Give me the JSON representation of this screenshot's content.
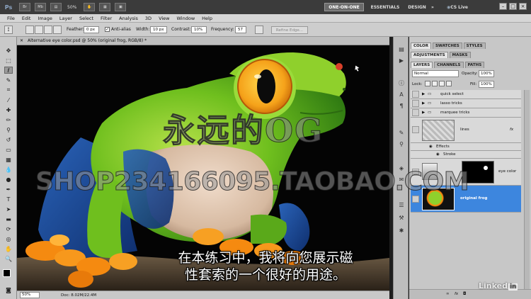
{
  "app": {
    "logo": "Ps",
    "mini_buttons": [
      "Br",
      "Mb"
    ],
    "zoom": "50%",
    "workspaces": [
      {
        "label": "ONE-ON-ONE",
        "active": true
      },
      {
        "label": "ESSENTIALS",
        "active": false
      },
      {
        "label": "DESIGN",
        "active": false
      },
      {
        "label": "»",
        "active": false
      }
    ],
    "cs_live": "CS Live",
    "window_controls": [
      "–",
      "□",
      "×"
    ]
  },
  "menu": [
    "File",
    "Edit",
    "Image",
    "Layer",
    "Select",
    "Filter",
    "Analysis",
    "3D",
    "View",
    "Window",
    "Help"
  ],
  "options": {
    "feather_label": "Feather:",
    "feather_value": "0 px",
    "antialias_label": "Anti-alias",
    "antialias_checked": "✓",
    "width_label": "Width:",
    "width_value": "10 px",
    "contrast_label": "Contrast:",
    "contrast_value": "10%",
    "frequency_label": "Frequency:",
    "frequency_value": "57",
    "refine_label": "Refine Edge..."
  },
  "document": {
    "tab_title": "Alternative eye color.psd @ 50% (original frog, RGB/8) *",
    "status_zoom": "50%",
    "status_doc": "Doc: 8.02M/22.4M"
  },
  "panels": {
    "top_tabs": [
      "COLOR",
      "SWATCHES",
      "STYLES"
    ],
    "mid_tabs": [
      "ADJUSTMENTS",
      "MASKS"
    ],
    "layer_tabs": [
      "LAYERS",
      "CHANNELS",
      "PATHS"
    ],
    "blend_mode": "Normal",
    "opacity_label": "Opacity:",
    "opacity_value": "100%",
    "lock_label": "Lock:",
    "fill_label": "Fill:",
    "fill_value": "100%",
    "layers": [
      {
        "name": "quick select",
        "kind": "group"
      },
      {
        "name": "lasso tricks",
        "kind": "group"
      },
      {
        "name": "marquee tricks",
        "kind": "group"
      },
      {
        "name": "lines",
        "kind": "layer"
      },
      {
        "name": "Effects",
        "kind": "effect"
      },
      {
        "name": "Stroke",
        "kind": "effect"
      },
      {
        "name": "eye color",
        "kind": "layer"
      },
      {
        "name": "original frog",
        "kind": "layer"
      }
    ],
    "fx_label": "fx"
  },
  "overlay": {
    "watermark_cn": "永远的OG",
    "watermark_shop": "SHOP234166095.TAOBAO.COM",
    "subtitle_line1": "在本练习中，我将向您展示磁",
    "subtitle_line2": "性套索的一个很好的用途。",
    "brand": "Linked",
    "brand_in": "in"
  }
}
